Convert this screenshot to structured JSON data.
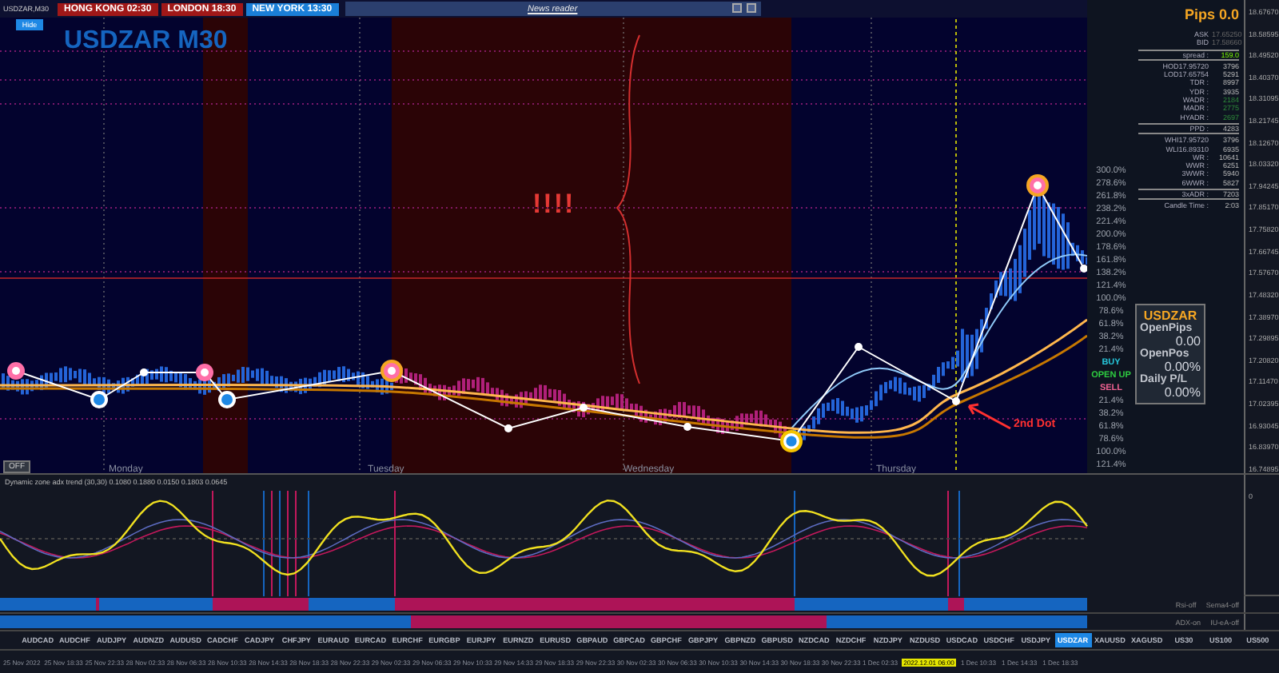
{
  "chart": {
    "symbol_tag": "USDZAR,M30",
    "title": "USDZAR M30",
    "hide_button": "Hide",
    "off_button": "OFF",
    "alert": "!!!!",
    "dot_note": "2nd Dot",
    "days": [
      "Monday",
      "Tuesday",
      "Wednesday",
      "Thursday"
    ]
  },
  "sessions": [
    {
      "label": "HONG KONG 02:30",
      "color": "#a01818"
    },
    {
      "label": "LONDON  18:30",
      "color": "#a01818"
    },
    {
      "label": "NEW YORK  13:30",
      "color": "#1a7fd8"
    }
  ],
  "news_reader": {
    "title": "News reader"
  },
  "stats": {
    "pips": "Pips 0.0",
    "rows": [
      {
        "label": "ASK",
        "value": "17.65250",
        "kind": "quote"
      },
      {
        "label": "BID",
        "value": "17.58660",
        "kind": "quote"
      },
      {
        "label": "spread :",
        "value": "159.0",
        "kind": "boxed"
      },
      {
        "label": "HOD17.95720",
        "value": "3796",
        "kind": "row"
      },
      {
        "label": "LOD17.65754",
        "value": "5291",
        "kind": "row"
      },
      {
        "label": "TDR :",
        "value": "8997",
        "kind": "row"
      },
      {
        "label": "YDR :",
        "value": "3935",
        "kind": "row"
      },
      {
        "label": "WADR :",
        "value": "2184",
        "kind": "good"
      },
      {
        "label": "MADR :",
        "value": "2775",
        "kind": "good"
      },
      {
        "label": "HYADR :",
        "value": "2697",
        "kind": "good"
      },
      {
        "label": "PPD :",
        "value": "4283",
        "kind": "boxed"
      },
      {
        "label": "WHI17.95720",
        "value": "3796",
        "kind": "row"
      },
      {
        "label": "WLI16.89310",
        "value": "6935",
        "kind": "row"
      },
      {
        "label": "WR :",
        "value": "10641",
        "kind": "row"
      },
      {
        "label": "WWR :",
        "value": "6251",
        "kind": "row"
      },
      {
        "label": "3WWR :",
        "value": "5940",
        "kind": "row"
      },
      {
        "label": "6WWR :",
        "value": "5827",
        "kind": "row"
      },
      {
        "label": "3xADR :",
        "value": "7203",
        "kind": "boxed"
      },
      {
        "label": "Candle Time :",
        "value": "2:03",
        "kind": "row"
      }
    ]
  },
  "levels": [
    {
      "text": "300.0%",
      "kind": "level"
    },
    {
      "text": "278.6%",
      "kind": "level"
    },
    {
      "text": "261.8%",
      "kind": "level"
    },
    {
      "text": "238.2%",
      "kind": "level"
    },
    {
      "text": "221.4%",
      "kind": "level"
    },
    {
      "text": "200.0%",
      "kind": "level"
    },
    {
      "text": "178.6%",
      "kind": "level"
    },
    {
      "text": "161.8%",
      "kind": "level"
    },
    {
      "text": "138.2%",
      "kind": "level"
    },
    {
      "text": "121.4%",
      "kind": "level"
    },
    {
      "text": "100.0%",
      "kind": "level"
    },
    {
      "text": "78.6%",
      "kind": "level"
    },
    {
      "text": "61.8%",
      "kind": "level"
    },
    {
      "text": "38.2%",
      "kind": "level"
    },
    {
      "text": "21.4%",
      "kind": "level"
    },
    {
      "text": "BUY",
      "kind": "buy"
    },
    {
      "text": "OPEN UP",
      "kind": "open"
    },
    {
      "text": "SELL",
      "kind": "sell"
    },
    {
      "text": "21.4%",
      "kind": "level"
    },
    {
      "text": "38.2%",
      "kind": "level"
    },
    {
      "text": "61.8%",
      "kind": "level"
    },
    {
      "text": "78.6%",
      "kind": "level"
    },
    {
      "text": "100.0%",
      "kind": "level"
    },
    {
      "text": "121.4%",
      "kind": "level"
    }
  ],
  "account": {
    "title": "USDZAR",
    "items": [
      {
        "label": "OpenPips",
        "value": "0.00"
      },
      {
        "label": "OpenPos",
        "value": "0.00%"
      },
      {
        "label": "Daily P/L",
        "value": "0.00%"
      }
    ]
  },
  "price_axis": [
    "18.67670",
    "18.58595",
    "18.49520",
    "18.40370",
    "18.31095",
    "18.21745",
    "18.12670",
    "18.03320",
    "17.94245",
    "17.85170",
    "17.75820",
    "17.66745",
    "17.57670",
    "17.48320",
    "17.38970",
    "17.29895",
    "17.20820",
    "17.11470",
    "17.02395",
    "16.93045",
    "16.83970",
    "16.74895"
  ],
  "indicator": {
    "title": "Dynamic zone adx trend (30,30) 0.1080 0.1880 0.0150 0.1803 0.0645",
    "axis": "0"
  },
  "strips": [
    {
      "labels": [
        "Rsi-off",
        "Sema4-off"
      ]
    },
    {
      "labels": [
        "ADX-on",
        "IU-eA-off"
      ]
    }
  ],
  "symbols": [
    {
      "name": "AUDCAD",
      "selected": false
    },
    {
      "name": "AUDCHF",
      "selected": false
    },
    {
      "name": "AUDJPY",
      "selected": false
    },
    {
      "name": "AUDNZD",
      "selected": false
    },
    {
      "name": "AUDUSD",
      "selected": false
    },
    {
      "name": "CADCHF",
      "selected": false
    },
    {
      "name": "CADJPY",
      "selected": false
    },
    {
      "name": "CHFJPY",
      "selected": false
    },
    {
      "name": "EURAUD",
      "selected": false
    },
    {
      "name": "EURCAD",
      "selected": false
    },
    {
      "name": "EURCHF",
      "selected": false
    },
    {
      "name": "EURGBP",
      "selected": false
    },
    {
      "name": "EURJPY",
      "selected": false
    },
    {
      "name": "EURNZD",
      "selected": false
    },
    {
      "name": "EURUSD",
      "selected": false
    },
    {
      "name": "GBPAUD",
      "selected": false
    },
    {
      "name": "GBPCAD",
      "selected": false
    },
    {
      "name": "GBPCHF",
      "selected": false
    },
    {
      "name": "GBPJPY",
      "selected": false
    },
    {
      "name": "GBPNZD",
      "selected": false
    },
    {
      "name": "GBPUSD",
      "selected": false
    },
    {
      "name": "NZDCAD",
      "selected": false
    },
    {
      "name": "NZDCHF",
      "selected": false
    },
    {
      "name": "NZDJPY",
      "selected": false
    },
    {
      "name": "NZDUSD",
      "selected": false
    },
    {
      "name": "USDCAD",
      "selected": false
    },
    {
      "name": "USDCHF",
      "selected": false
    },
    {
      "name": "USDJPY",
      "selected": false
    },
    {
      "name": "USDZAR",
      "selected": true
    },
    {
      "name": "XAUUSD",
      "selected": false
    },
    {
      "name": "XAGUSD",
      "selected": false
    },
    {
      "name": "US30",
      "selected": false
    },
    {
      "name": "US100",
      "selected": false
    },
    {
      "name": "US500",
      "selected": false
    }
  ],
  "time_axis": [
    {
      "text": "25 Nov 2022",
      "selected": false
    },
    {
      "text": "25 Nov 18:33",
      "selected": false
    },
    {
      "text": "25 Nov 22:33",
      "selected": false
    },
    {
      "text": "28 Nov 02:33",
      "selected": false
    },
    {
      "text": "28 Nov 06:33",
      "selected": false
    },
    {
      "text": "28 Nov 10:33",
      "selected": false
    },
    {
      "text": "28 Nov 14:33",
      "selected": false
    },
    {
      "text": "28 Nov 18:33",
      "selected": false
    },
    {
      "text": "28 Nov 22:33",
      "selected": false
    },
    {
      "text": "29 Nov 02:33",
      "selected": false
    },
    {
      "text": "29 Nov 06:33",
      "selected": false
    },
    {
      "text": "29 Nov 10:33",
      "selected": false
    },
    {
      "text": "29 Nov 14:33",
      "selected": false
    },
    {
      "text": "29 Nov 18:33",
      "selected": false
    },
    {
      "text": "29 Nov 22:33",
      "selected": false
    },
    {
      "text": "30 Nov 02:33",
      "selected": false
    },
    {
      "text": "30 Nov 06:33",
      "selected": false
    },
    {
      "text": "30 Nov 10:33",
      "selected": false
    },
    {
      "text": "30 Nov 14:33",
      "selected": false
    },
    {
      "text": "30 Nov 18:33",
      "selected": false
    },
    {
      "text": "30 Nov 22:33",
      "selected": false
    },
    {
      "text": "1 Dec 02:33",
      "selected": false
    },
    {
      "text": "2022.12.01 06:00",
      "selected": true
    },
    {
      "text": "1 Dec 10:33",
      "selected": false
    },
    {
      "text": "1 Dec 14:33",
      "selected": false
    },
    {
      "text": "1 Dec 18:33",
      "selected": false
    }
  ]
}
